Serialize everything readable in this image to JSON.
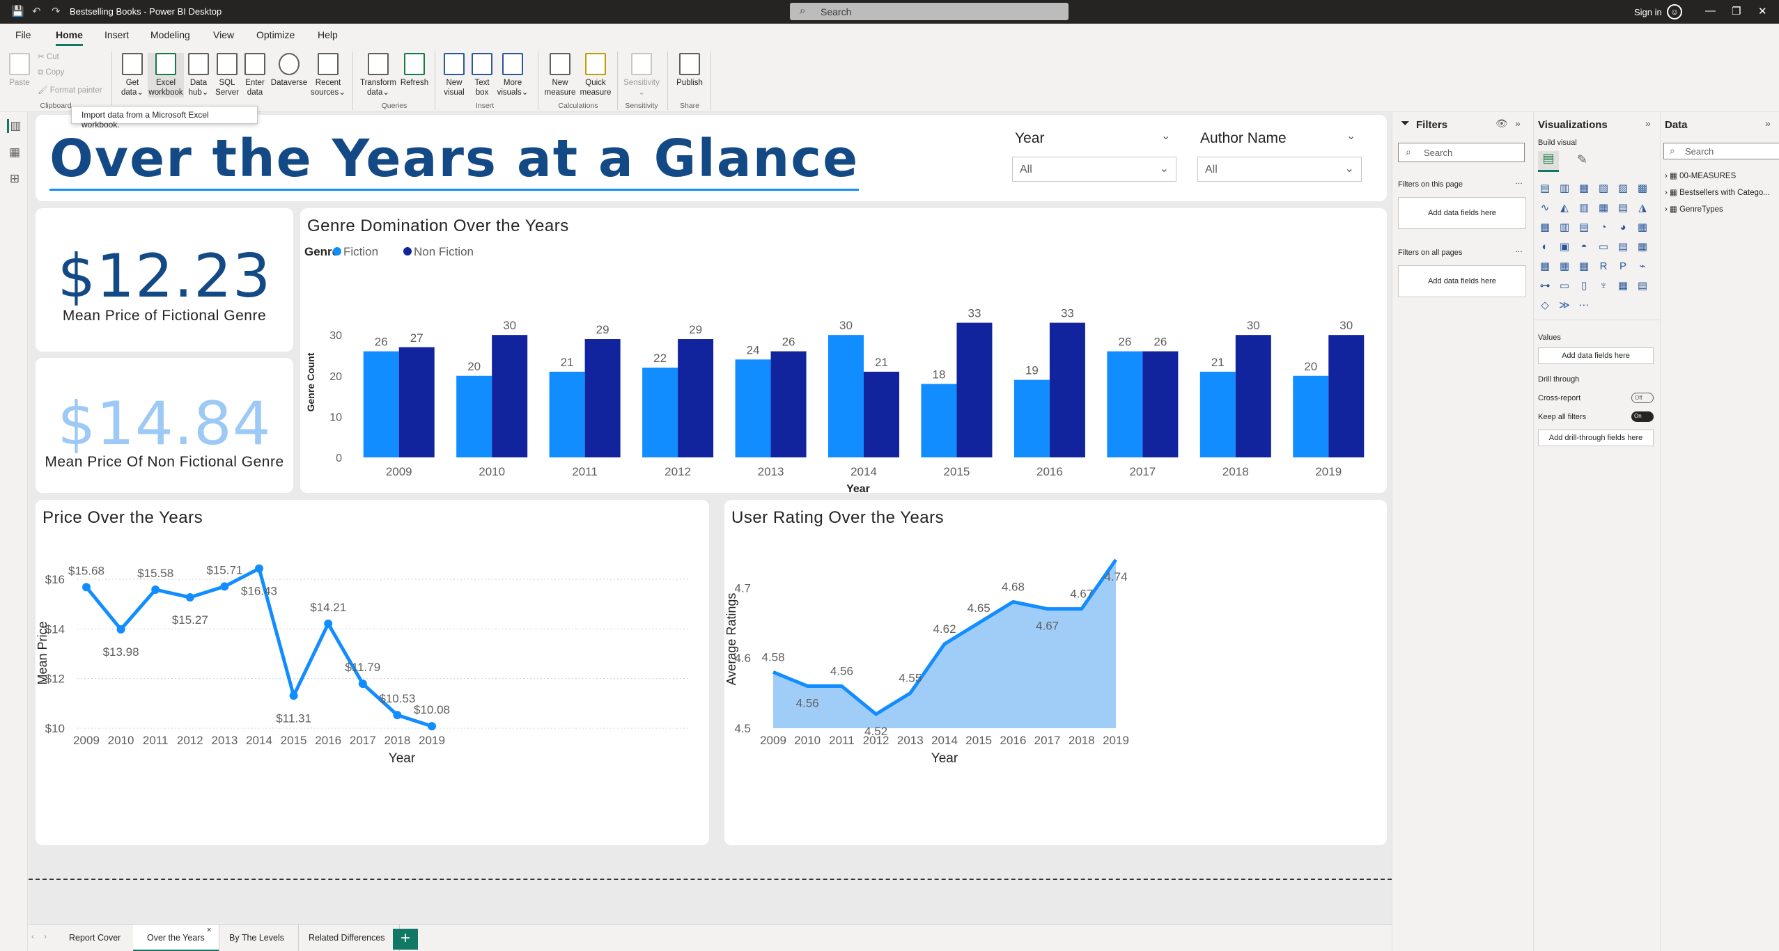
{
  "window": {
    "title": "Bestselling Books - Power BI Desktop",
    "search_placeholder": "Search",
    "sign_in": "Sign in"
  },
  "menu": [
    "File",
    "Home",
    "Insert",
    "Modeling",
    "View",
    "Optimize",
    "Help"
  ],
  "ribbon": {
    "paste": "Paste",
    "cut": "Cut",
    "copy": "Copy",
    "format_painter": "Format painter",
    "groups": {
      "clipboard": "Clipboard",
      "queries": "Queries",
      "insert": "Insert",
      "calculations": "Calculations",
      "sensitivity": "Sensitivity",
      "share": "Share"
    },
    "buttons": {
      "get_data": [
        "Get",
        "data"
      ],
      "excel": [
        "Excel",
        "workbook"
      ],
      "data_hub": [
        "Data",
        "hub"
      ],
      "sql": [
        "SQL",
        "Server"
      ],
      "enter": [
        "Enter",
        "data"
      ],
      "dataverse": [
        "Dataverse",
        ""
      ],
      "recent": [
        "Recent",
        "sources"
      ],
      "transform": [
        "Transform",
        "data"
      ],
      "refresh": [
        "Refresh",
        ""
      ],
      "new_visual": [
        "New",
        "visual"
      ],
      "text_box": [
        "Text",
        "box"
      ],
      "more_visuals": [
        "More",
        "visuals"
      ],
      "new_measure": [
        "New",
        "measure"
      ],
      "quick_measure": [
        "Quick",
        "measure"
      ],
      "sensitivity": [
        "Sensitivity",
        ""
      ],
      "publish": [
        "Publish",
        ""
      ]
    },
    "tooltip": "Import data from a Microsoft Excel workbook."
  },
  "report": {
    "title": "Over the Years at a Glance",
    "slicers": [
      {
        "label": "Year",
        "value": "All"
      },
      {
        "label": "Author Name",
        "value": "All"
      }
    ],
    "kpi1": {
      "value": "$12.23",
      "label": "Mean Price of Fictional Genre",
      "color": "#134a86"
    },
    "kpi2": {
      "value": "$14.84",
      "label": "Mean Price Of Non Fictional Genre",
      "color": "#9cc9f5"
    }
  },
  "colors": {
    "fiction": "#118dff",
    "non_fiction": "#12239e",
    "line": "#118dff",
    "area": "#a0cdf8"
  },
  "chart_data": [
    {
      "type": "bar",
      "title": "Genre Domination Over the Years",
      "legend_title": "Genre",
      "categories": [
        "2009",
        "2010",
        "2011",
        "2012",
        "2013",
        "2014",
        "2015",
        "2016",
        "2017",
        "2018",
        "2019"
      ],
      "series": [
        {
          "name": "Fiction",
          "values": [
            26,
            20,
            21,
            22,
            24,
            30,
            18,
            19,
            26,
            21,
            20
          ]
        },
        {
          "name": "Non Fiction",
          "values": [
            27,
            30,
            29,
            29,
            26,
            21,
            33,
            33,
            26,
            30,
            30
          ]
        }
      ],
      "xlabel": "Year",
      "ylabel": "Genre Count",
      "yticks": [
        0,
        10,
        20,
        30
      ],
      "ylim": [
        0,
        36
      ],
      "legend": "top-left"
    },
    {
      "type": "line",
      "title": "Price Over the Years",
      "x": [
        "2009",
        "2010",
        "2011",
        "2012",
        "2013",
        "2014",
        "2015",
        "2016",
        "2017",
        "2018",
        "2019"
      ],
      "values": [
        15.68,
        13.98,
        15.58,
        15.27,
        15.71,
        16.43,
        11.31,
        14.21,
        11.79,
        10.53,
        10.08
      ],
      "labels": [
        "$15.68",
        "$13.98",
        "$15.58",
        "$15.27",
        "$15.71",
        "$16.43",
        "$11.31",
        "$14.21",
        "$11.79",
        "$10.53",
        "$10.08"
      ],
      "xlabel": "Year",
      "ylabel": "Mean Price",
      "yticks": [
        10,
        12,
        14,
        16
      ],
      "ytick_labels": [
        "$10",
        "$12",
        "$14",
        "$16"
      ],
      "ylim": [
        10,
        16.6
      ],
      "grid": true
    },
    {
      "type": "area",
      "title": "User Rating Over the Years",
      "x": [
        "2009",
        "2010",
        "2011",
        "2012",
        "2013",
        "2014",
        "2015",
        "2016",
        "2017",
        "2018",
        "2019"
      ],
      "values": [
        4.58,
        4.56,
        4.56,
        4.52,
        4.55,
        4.62,
        4.65,
        4.68,
        4.67,
        4.67,
        4.74
      ],
      "labels": [
        "4.58",
        "4.56",
        "4.56",
        "4.52",
        "4.55",
        "4.62",
        "4.65",
        "4.68",
        "4.67",
        "4.67",
        "4.74"
      ],
      "xlabel": "Year",
      "ylabel": "Average Ratings",
      "yticks": [
        4.5,
        4.6,
        4.7
      ],
      "ylim": [
        4.5,
        4.75
      ]
    }
  ],
  "filters": {
    "title": "Filters",
    "search": "Search",
    "on_page": "Filters on this page",
    "on_all": "Filters on all pages",
    "add": "Add data fields here"
  },
  "viz": {
    "title": "Visualizations",
    "build": "Build visual",
    "values": "Values",
    "add_values": "Add data fields here",
    "drill": "Drill through",
    "cross_report": "Cross-report",
    "cross_state": "Off",
    "keep_filters": "Keep all filters",
    "keep_state": "On",
    "add_drill": "Add drill-through fields here"
  },
  "data_pane": {
    "title": "Data",
    "search": "Search",
    "tables": [
      "00-MEASURES",
      "Bestsellers with Catego...",
      "GenreTypes"
    ]
  },
  "tabs": [
    "Report Cover",
    "Over the Years",
    "By The Levels",
    "Related Differences"
  ],
  "add_tab": "+"
}
